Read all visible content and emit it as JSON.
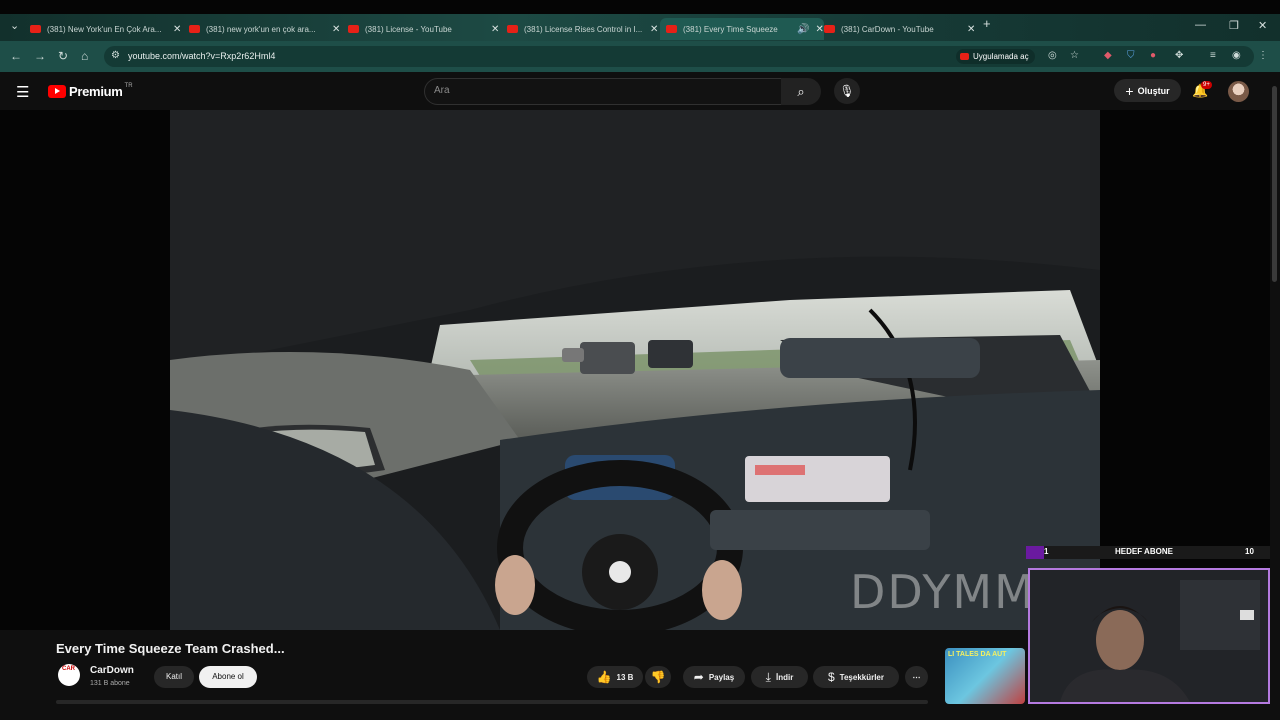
{
  "browser": {
    "tabs": [
      {
        "title": "(381) New York'un En Çok Ara...",
        "active": false
      },
      {
        "title": "(381) new york'un en çok ara...",
        "active": false
      },
      {
        "title": "(381) License - YouTube",
        "active": false
      },
      {
        "title": "(381) License Rises Control in I...",
        "active": false
      },
      {
        "title": "(381) Every Time Squeeze",
        "active": true
      },
      {
        "title": "(381) CarDown - YouTube",
        "active": false
      }
    ],
    "url": "youtube.com/watch?v=Rxp2r62Hml4",
    "open_in_app": "Uygulamada aç"
  },
  "yt": {
    "logo_text": "Premium",
    "country_code": "TR",
    "search_placeholder": "Ara",
    "create_label": "Oluştur",
    "notification_badge": "9+"
  },
  "video": {
    "title": "Every Time Squeeze Team Crashed...",
    "watermark": "DDYMM",
    "channel": {
      "name": "CarDown",
      "subscribers": "131 B abone",
      "avatar_text": "CAR"
    },
    "join_label": "Katıl",
    "subscribe_label": "Abone ol",
    "likes": "13 B",
    "share_label": "Paylaş",
    "download_label": "İndir",
    "thanks_label": "Teşekkürler"
  },
  "recommended": {
    "thumb_text": "LI TALES DA AUT"
  },
  "overlay": {
    "goal_label": "HEDEF ABONE",
    "current": "1",
    "target": "10"
  },
  "colors": {
    "accent": "#ff0000",
    "overlay_border": "#b57ae0",
    "browser_theme": "#1e4e48"
  }
}
